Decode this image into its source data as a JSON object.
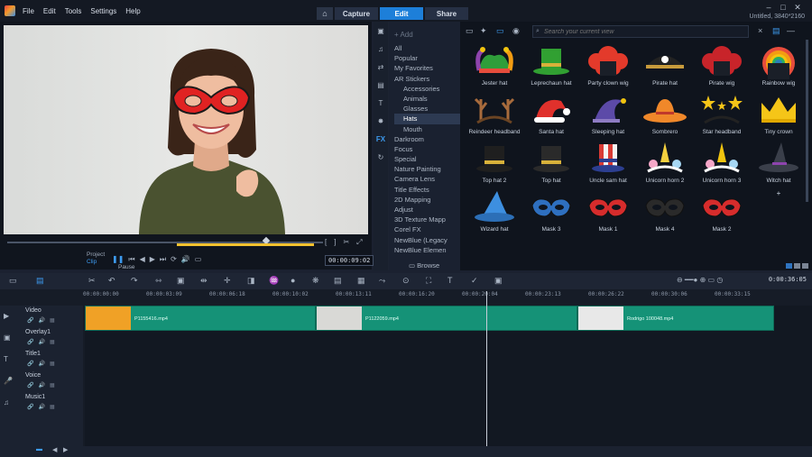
{
  "menu": [
    "File",
    "Edit",
    "Tools",
    "Settings",
    "Help"
  ],
  "modes": {
    "capture": "Capture",
    "edit": "Edit",
    "share": "Share"
  },
  "window": {
    "project_info": "Untitled, 3840*2160",
    "minimize": "–",
    "maximize": "□",
    "close": "✕"
  },
  "preview": {
    "project_label": "Project",
    "clip_label": "Clip",
    "pause_tooltip": "Pause",
    "timecode": "00:00:09:02",
    "zoom_label": "1"
  },
  "library": {
    "add_label": "Add",
    "search_placeholder": "Search your current view",
    "browse_label": "Browse",
    "categories": [
      {
        "label": "All",
        "sub": false,
        "selected": false
      },
      {
        "label": "Popular",
        "sub": false,
        "selected": false
      },
      {
        "label": "My Favorites",
        "sub": false,
        "selected": false
      },
      {
        "label": "AR Stickers",
        "sub": false,
        "selected": false
      },
      {
        "label": "Accessories",
        "sub": true,
        "selected": false
      },
      {
        "label": "Animals",
        "sub": true,
        "selected": false
      },
      {
        "label": "Glasses",
        "sub": true,
        "selected": false
      },
      {
        "label": "Hats",
        "sub": true,
        "selected": true
      },
      {
        "label": "Mouth",
        "sub": true,
        "selected": false
      },
      {
        "label": "Darkroom",
        "sub": false,
        "selected": false
      },
      {
        "label": "Focus",
        "sub": false,
        "selected": false
      },
      {
        "label": "Special",
        "sub": false,
        "selected": false
      },
      {
        "label": "Nature Painting",
        "sub": false,
        "selected": false
      },
      {
        "label": "Camera Lens",
        "sub": false,
        "selected": false
      },
      {
        "label": "Title Effects",
        "sub": false,
        "selected": false
      },
      {
        "label": "2D Mapping",
        "sub": false,
        "selected": false
      },
      {
        "label": "Adjust",
        "sub": false,
        "selected": false
      },
      {
        "label": "3D Texture Mapp",
        "sub": false,
        "selected": false
      },
      {
        "label": "Corel FX",
        "sub": false,
        "selected": false
      },
      {
        "label": "NewBlue (Legacy",
        "sub": false,
        "selected": false
      },
      {
        "label": "NewBlue Elemen",
        "sub": false,
        "selected": false
      }
    ],
    "assets": [
      {
        "label": "Jester hat",
        "kind": "jester",
        "color": "#2f9e3a"
      },
      {
        "label": "Leprechaun hat",
        "kind": "tophat",
        "color": "#31a032"
      },
      {
        "label": "Party clown wig",
        "kind": "wig",
        "color": "#e33a2b"
      },
      {
        "label": "Pirate hat",
        "kind": "pirate",
        "color": "#222222"
      },
      {
        "label": "Pirate wig",
        "kind": "wig",
        "color": "#c8242a"
      },
      {
        "label": "Rainbow wig",
        "kind": "rainbow",
        "color": "#f04c3c"
      },
      {
        "label": "Reindeer headband",
        "kind": "antlers",
        "color": "#a86b3c"
      },
      {
        "label": "Santa hat",
        "kind": "santa",
        "color": "#e0312c"
      },
      {
        "label": "Sleeping hat",
        "kind": "sleep",
        "color": "#5c4aa8"
      },
      {
        "label": "Sombrero",
        "kind": "sombrero",
        "color": "#f0882a"
      },
      {
        "label": "Star headband",
        "kind": "stars",
        "color": "#f5c518"
      },
      {
        "label": "Tiny crown",
        "kind": "crown",
        "color": "#f5c518"
      },
      {
        "label": "Top hat 2",
        "kind": "tophat",
        "color": "#1f1f1f"
      },
      {
        "label": "Top hat",
        "kind": "tophat",
        "color": "#2a2a2a"
      },
      {
        "label": "Uncle sam hat",
        "kind": "unclesam",
        "color": "#d93a34"
      },
      {
        "label": "Unicorn horn 2",
        "kind": "unicorn",
        "color": "#f4d03f"
      },
      {
        "label": "Unicorn horn 3",
        "kind": "unicorn",
        "color": "#f1c40f"
      },
      {
        "label": "Witch hat",
        "kind": "witch",
        "color": "#3a3f4a"
      },
      {
        "label": "Wizard hat",
        "kind": "wizard",
        "color": "#3d8fe0"
      },
      {
        "label": "Mask 3",
        "kind": "mask",
        "color": "#2e6fbf"
      },
      {
        "label": "Mask 1",
        "kind": "mask",
        "color": "#d62c2c"
      },
      {
        "label": "Mask 4",
        "kind": "mask",
        "color": "#2a2a2a"
      },
      {
        "label": "Mask 2",
        "kind": "mask",
        "color": "#d62c2c"
      }
    ]
  },
  "timeline": {
    "timecode": "0:00:36:05",
    "ruler": [
      "00:00:00:00",
      "00:00:03:09",
      "00:00:06:18",
      "00:00:10:02",
      "00:00:13:11",
      "00:00:16:20",
      "00:00:20:04",
      "00:00:23:13",
      "00:00:26:22",
      "00:00:30:06",
      "00:00:33:15"
    ],
    "tracks": [
      {
        "name": "Video",
        "icon": "video-icon"
      },
      {
        "name": "Overlay1",
        "icon": "overlay-icon"
      },
      {
        "name": "Title1",
        "icon": "title-icon"
      },
      {
        "name": "Voice",
        "icon": "microphone-icon"
      },
      {
        "name": "Music1",
        "icon": "music-icon"
      }
    ],
    "clips": [
      {
        "label": "P1155416.mp4",
        "thumb": "#f0a126"
      },
      {
        "label": "P1122059.mp4",
        "thumb": "#d9d9d6"
      },
      {
        "label": "Rodrigo 100048.mp4",
        "thumb": "#e8e8e8"
      }
    ]
  }
}
